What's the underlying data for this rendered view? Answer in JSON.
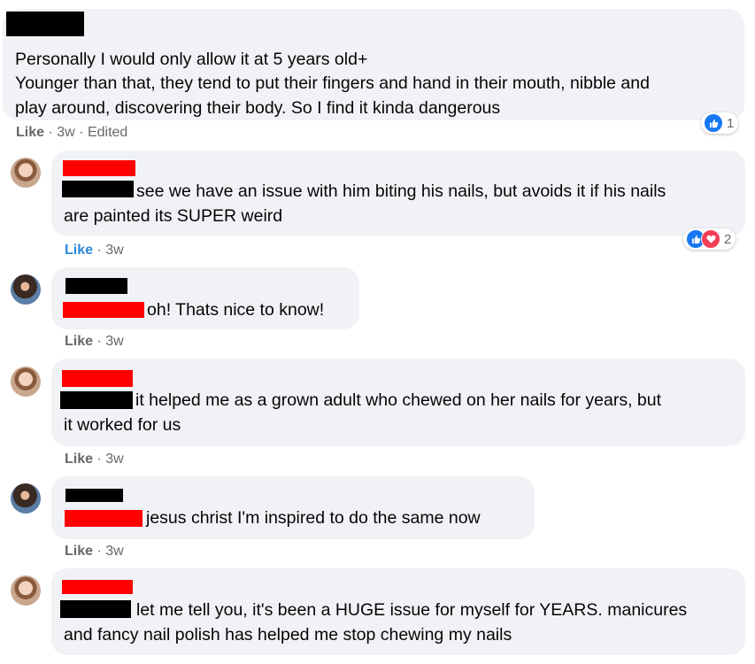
{
  "comments": [
    {
      "lines": [
        "Personally I would only allow it at 5 years old+",
        "Younger than that, they tend to put their fingers and hand in their mouth, nibble and",
        "play around, discovering their body. So I find it kinda dangerous"
      ],
      "like": "Like",
      "time": "3w",
      "edited": "Edited",
      "reactions": {
        "count": "1"
      }
    },
    {
      "lines": [
        "see we have an issue with him biting his nails, but avoids it if his nails",
        "are painted its SUPER weird"
      ],
      "like": "Like",
      "time": "3w",
      "reactions": {
        "count": "2"
      }
    },
    {
      "lines": [
        "oh! Thats nice to know!"
      ],
      "like": "Like",
      "time": "3w"
    },
    {
      "lines": [
        "it helped me as a grown adult who chewed on her nails for years, but",
        "it worked for us"
      ],
      "like": "Like",
      "time": "3w"
    },
    {
      "lines": [
        "jesus christ I'm inspired to do the same now"
      ],
      "like": "Like",
      "time": "3w"
    },
    {
      "lines": [
        "let me tell you, it's been a HUGE issue for myself for YEARS. manicures",
        "and fancy nail polish has helped me stop chewing my nails"
      ],
      "like": "Like",
      "time": "3w"
    }
  ],
  "colors": {
    "like_blue": "#2d88d9",
    "bubble_bg": "#f0f2f5",
    "meta_gray": "#65676b",
    "redaction_red": "#ff0000",
    "redaction_black": "#000000"
  },
  "icons": [
    "like-reaction-icon",
    "love-reaction-icon",
    "avatar"
  ]
}
